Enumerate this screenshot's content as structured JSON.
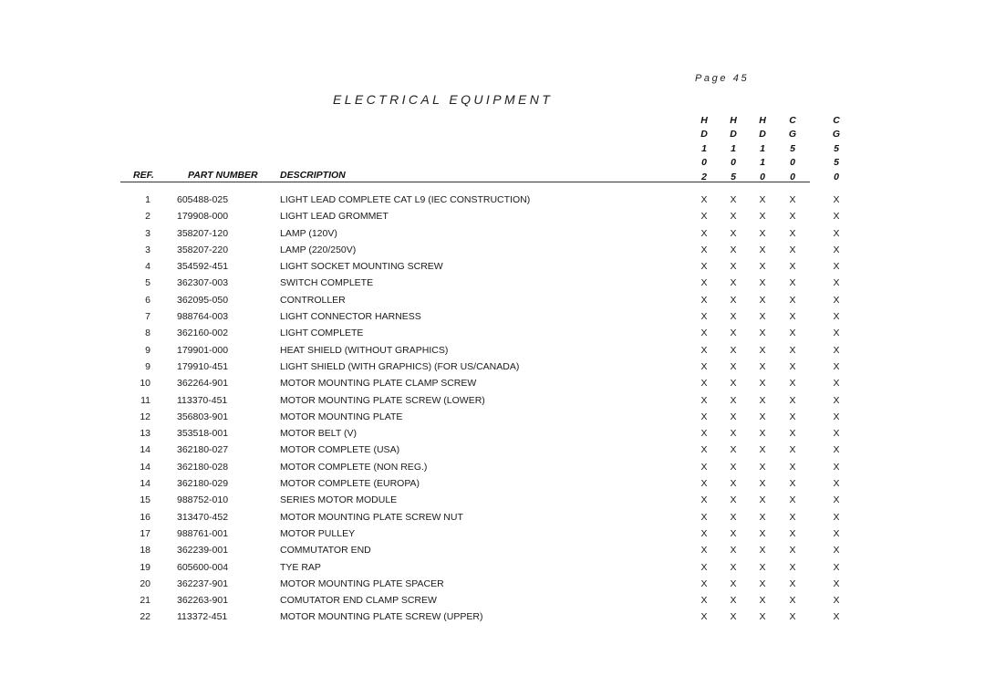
{
  "page_label": "Page 45",
  "title": "ELECTRICAL EQUIPMENT",
  "headers": {
    "ref": "REF.",
    "part_number": "PART NUMBER",
    "description": "DESCRIPTION"
  },
  "model_columns": [
    {
      "chars": [
        "H",
        "D",
        "1",
        "0",
        "2"
      ],
      "model": "HD102"
    },
    {
      "chars": [
        "H",
        "D",
        "1",
        "0",
        "5"
      ],
      "model": "HD105"
    },
    {
      "chars": [
        "H",
        "D",
        "1",
        "1",
        "0"
      ],
      "model": "HD110"
    },
    {
      "chars": [
        "C",
        "G",
        "5",
        "0",
        "0"
      ],
      "model": "CG500"
    },
    {
      "chars": [
        "C",
        "G",
        "5",
        "5",
        "0"
      ],
      "model": "CG550"
    }
  ],
  "rows": [
    {
      "ref": "1",
      "part": "605488-025",
      "desc": "LIGHT LEAD COMPLETE CAT L9 (IEC CONSTRUCTION)",
      "marks": [
        "X",
        "X",
        "X",
        "X",
        "X"
      ]
    },
    {
      "ref": "2",
      "part": "179908-000",
      "desc": "LIGHT LEAD GROMMET",
      "marks": [
        "X",
        "X",
        "X",
        "X",
        "X"
      ]
    },
    {
      "ref": "3",
      "part": "358207-120",
      "desc": "LAMP (120V)",
      "marks": [
        "X",
        "X",
        "X",
        "X",
        "X"
      ]
    },
    {
      "ref": "3",
      "part": "358207-220",
      "desc": "LAMP (220/250V)",
      "marks": [
        "X",
        "X",
        "X",
        "X",
        "X"
      ]
    },
    {
      "ref": "4",
      "part": "354592-451",
      "desc": "LIGHT SOCKET MOUNTING SCREW",
      "marks": [
        "X",
        "X",
        "X",
        "X",
        "X"
      ]
    },
    {
      "ref": "5",
      "part": "362307-003",
      "desc": "SWITCH COMPLETE",
      "marks": [
        "X",
        "X",
        "X",
        "X",
        "X"
      ]
    },
    {
      "ref": "6",
      "part": "362095-050",
      "desc": "CONTROLLER",
      "marks": [
        "X",
        "X",
        "X",
        "X",
        "X"
      ]
    },
    {
      "ref": "7",
      "part": "988764-003",
      "desc": "LIGHT CONNECTOR HARNESS",
      "marks": [
        "X",
        "X",
        "X",
        "X",
        "X"
      ]
    },
    {
      "ref": "8",
      "part": "362160-002",
      "desc": "LIGHT COMPLETE",
      "marks": [
        "X",
        "X",
        "X",
        "X",
        "X"
      ]
    },
    {
      "ref": "9",
      "part": "179901-000",
      "desc": "HEAT SHIELD (WITHOUT GRAPHICS)",
      "marks": [
        "X",
        "X",
        "X",
        "X",
        "X"
      ]
    },
    {
      "ref": "9",
      "part": "179910-451",
      "desc": "LIGHT SHIELD (WITH GRAPHICS) (FOR US/CANADA)",
      "marks": [
        "X",
        "X",
        "X",
        "X",
        "X"
      ]
    },
    {
      "ref": "10",
      "part": "362264-901",
      "desc": "MOTOR MOUNTING PLATE CLAMP SCREW",
      "marks": [
        "X",
        "X",
        "X",
        "X",
        "X"
      ]
    },
    {
      "ref": "11",
      "part": "113370-451",
      "desc": "MOTOR MOUNTING PLATE SCREW (LOWER)",
      "marks": [
        "X",
        "X",
        "X",
        "X",
        "X"
      ]
    },
    {
      "ref": "12",
      "part": "356803-901",
      "desc": "MOTOR MOUNTING PLATE",
      "marks": [
        "X",
        "X",
        "X",
        "X",
        "X"
      ]
    },
    {
      "ref": "13",
      "part": "353518-001",
      "desc": "MOTOR BELT (V)",
      "marks": [
        "X",
        "X",
        "X",
        "X",
        "X"
      ]
    },
    {
      "ref": "14",
      "part": "362180-027",
      "desc": "MOTOR COMPLETE (USA)",
      "marks": [
        "X",
        "X",
        "X",
        "X",
        "X"
      ]
    },
    {
      "ref": "14",
      "part": "362180-028",
      "desc": "MOTOR COMPLETE (NON REG.)",
      "marks": [
        "X",
        "X",
        "X",
        "X",
        "X"
      ]
    },
    {
      "ref": "14",
      "part": "362180-029",
      "desc": "MOTOR COMPLETE (EUROPA)",
      "marks": [
        "X",
        "X",
        "X",
        "X",
        "X"
      ]
    },
    {
      "ref": "15",
      "part": "988752-010",
      "desc": "SERIES MOTOR MODULE",
      "marks": [
        "X",
        "X",
        "X",
        "X",
        "X"
      ]
    },
    {
      "ref": "16",
      "part": "313470-452",
      "desc": "MOTOR MOUNTING PLATE SCREW NUT",
      "marks": [
        "X",
        "X",
        "X",
        "X",
        "X"
      ]
    },
    {
      "ref": "17",
      "part": "988761-001",
      "desc": "MOTOR PULLEY",
      "marks": [
        "X",
        "X",
        "X",
        "X",
        "X"
      ]
    },
    {
      "ref": "18",
      "part": "362239-001",
      "desc": "COMMUTATOR END",
      "marks": [
        "X",
        "X",
        "X",
        "X",
        "X"
      ]
    },
    {
      "ref": "19",
      "part": "605600-004",
      "desc": "TYE RAP",
      "marks": [
        "X",
        "X",
        "X",
        "X",
        "X"
      ]
    },
    {
      "ref": "20",
      "part": "362237-901",
      "desc": "MOTOR MOUNTING PLATE SPACER",
      "marks": [
        "X",
        "X",
        "X",
        "X",
        "X"
      ]
    },
    {
      "ref": "21",
      "part": "362263-901",
      "desc": "COMUTATOR END CLAMP SCREW",
      "marks": [
        "X",
        "X",
        "X",
        "X",
        "X"
      ]
    },
    {
      "ref": "22",
      "part": "113372-451",
      "desc": "MOTOR MOUNTING PLATE SCREW (UPPER)",
      "marks": [
        "X",
        "X",
        "X",
        "X",
        "X"
      ]
    }
  ]
}
